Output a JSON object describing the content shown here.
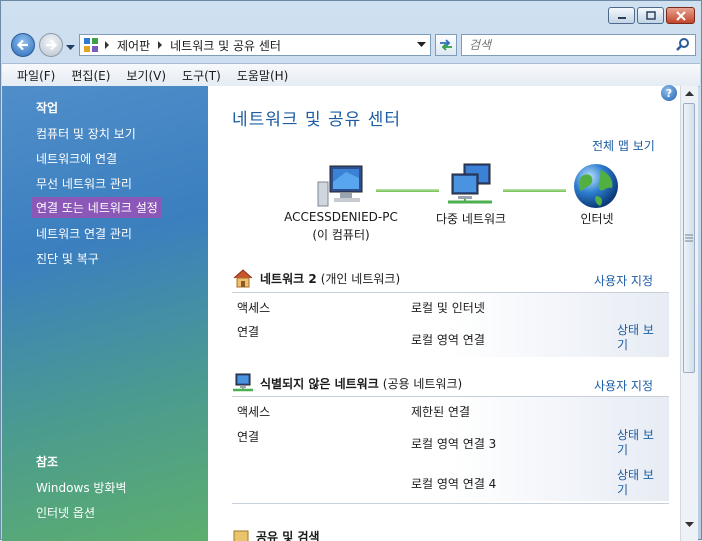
{
  "breadcrumb": [
    "제어판",
    "네트워크 및 공유 센터"
  ],
  "search": {
    "placeholder": "검색"
  },
  "menu": [
    "파일(F)",
    "편집(E)",
    "보기(V)",
    "도구(T)",
    "도움말(H)"
  ],
  "sidebar": {
    "tasks_heading": "작업",
    "tasks": [
      "컴퓨터 및 장치 보기",
      "네트워크에 연결",
      "무선 네트워크 관리",
      "연결 또는 네트워크 설정",
      "네트워크 연결 관리",
      "진단 및 복구"
    ],
    "highlighted_task": "연결 또는 네트워크 설정",
    "see_also_heading": "참조",
    "see_also": [
      "Windows 방화벽",
      "인터넷 옵션"
    ]
  },
  "main": {
    "title": "네트워크 및 공유 센터",
    "full_map_link": "전체 맵 보기",
    "map": {
      "computer_name": "ACCESSDENIED-PC",
      "computer_sub": "(이 컴퓨터)",
      "multiple_networks": "다중 네트워크",
      "internet": "인터넷"
    },
    "networks": [
      {
        "name": "네트워크 2",
        "type": "(개인 네트워크)",
        "customize": "사용자 지정",
        "access_label": "액세스",
        "access_value": "로컬 및 인터넷",
        "connection_label": "연결",
        "connections": [
          {
            "name": "로컬 영역 연결",
            "status_link": "상태 보기"
          }
        ]
      },
      {
        "name": "식별되지 않은 네트워크",
        "type": "(공용 네트워크)",
        "customize": "사용자 지정",
        "access_label": "액세스",
        "access_value": "제한된 연결",
        "connection_label": "연결",
        "connections": [
          {
            "name": "로컬 영역 연결 3",
            "status_link": "상태 보기"
          },
          {
            "name": "로컬 영역 연결 4",
            "status_link": "상태 보기"
          }
        ]
      }
    ],
    "next_section_partial": "공유 및 검색"
  },
  "colors": {
    "link": "#1c5da4",
    "highlight": "#8c58b8"
  }
}
